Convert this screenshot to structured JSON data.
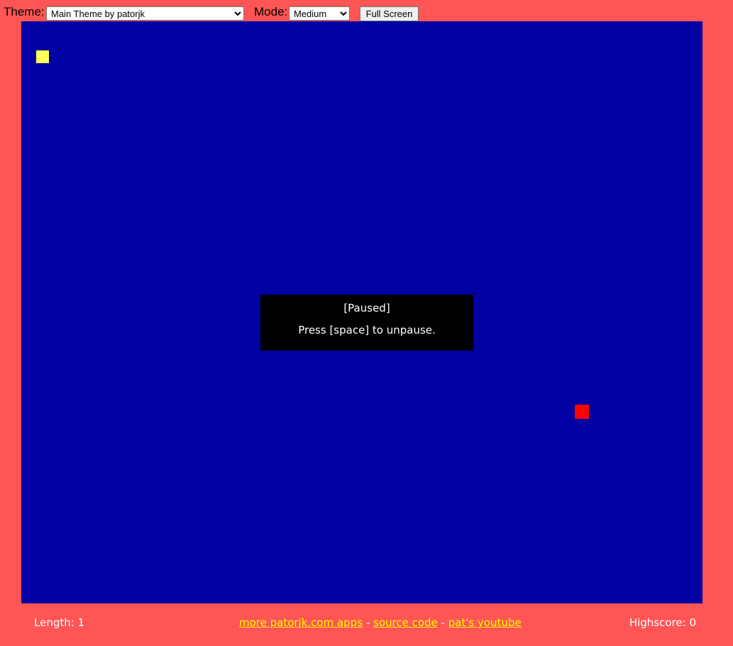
{
  "toolbar": {
    "theme_label": "Theme:",
    "theme_value": "Main Theme by patorjk",
    "mode_label": "Mode:",
    "mode_value": "Medium",
    "fullscreen_label": "Full Screen"
  },
  "game": {
    "state": "paused",
    "snake_length": 1,
    "colors": {
      "page_background": "#ff5555",
      "board_background": "#0000a3",
      "snake": "#ffff55",
      "food": "#ff0000",
      "dialog_background": "#000000"
    }
  },
  "pause_dialog": {
    "title": "[Paused]",
    "hint": "Press [space] to unpause."
  },
  "footer": {
    "length_text": "Length: 1",
    "link_more_apps": "more patorjk.com apps",
    "sep1": " - ",
    "link_source": "source code",
    "sep2": " - ",
    "link_youtube": "pat's youtube",
    "highscore_text": "Highscore: 0"
  }
}
